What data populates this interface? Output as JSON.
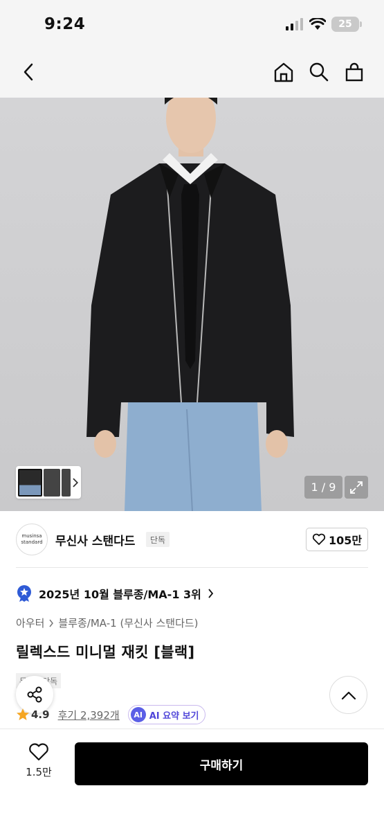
{
  "status": {
    "time": "9:24",
    "battery": "25"
  },
  "nav": {
    "back_icon": "chevron-left-icon",
    "home_icon": "home-icon",
    "search_icon": "search-icon",
    "cart_icon": "shopping-bag-icon"
  },
  "gallery": {
    "counter": "1 / 9"
  },
  "brand": {
    "logo_line1": "musinsa",
    "logo_line2": "standard",
    "name": "무신사 스탠다드",
    "badge": "단독",
    "likes": "105만"
  },
  "ranking": {
    "text": "2025년 10월 블루종/MA-1 3위"
  },
  "category": {
    "level1": "아우터",
    "level2": "블루종/MA-1 (무신사 스탠다드)"
  },
  "product": {
    "title": "릴렉스드 미니멀 재킷 [블랙]",
    "tag": "무신사단독"
  },
  "rating": {
    "score": "4.9",
    "reviews": "후기 2,392개",
    "ai_badge": "AI",
    "ai_label": "AI 요약 보기"
  },
  "bottom": {
    "wish_count": "1.5만",
    "buy_label": "구매하기"
  },
  "colors": {
    "accent": "#5046d9",
    "buy_button": "#000000",
    "star": "#f5a623",
    "rank_badge": "#2f5bd6"
  }
}
